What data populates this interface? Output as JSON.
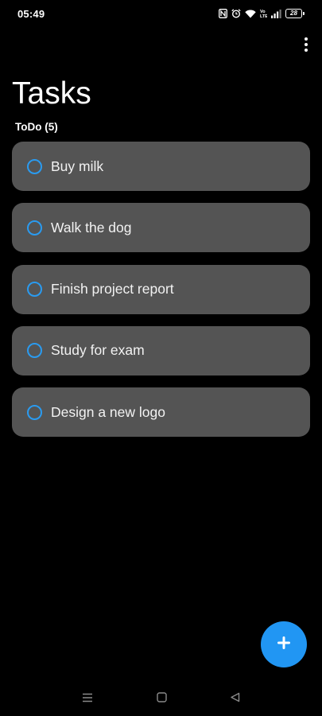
{
  "status_bar": {
    "time": "05:49",
    "battery_level": "28",
    "icons": [
      "nfc-icon",
      "alarm-icon",
      "wifi-icon",
      "volte-icon",
      "signal-icon",
      "battery-icon"
    ]
  },
  "app_bar": {
    "menu_icon": "more-vertical-icon"
  },
  "page": {
    "title": "Tasks",
    "section_header": "ToDo (5)"
  },
  "tasks": [
    {
      "label": "Buy milk",
      "completed": false
    },
    {
      "label": "Walk the dog",
      "completed": false
    },
    {
      "label": "Finish project report",
      "completed": false
    },
    {
      "label": "Study for exam",
      "completed": false
    },
    {
      "label": "Design a new logo",
      "completed": false
    }
  ],
  "fab": {
    "icon": "plus-icon"
  },
  "nav_bar": {
    "buttons": [
      "menu-icon",
      "home-icon",
      "back-icon"
    ]
  },
  "colors": {
    "background": "#000000",
    "card": "#545454",
    "accent": "#2196f3",
    "checkbox_ring": "#2a9bf0",
    "text": "#ffffff"
  }
}
